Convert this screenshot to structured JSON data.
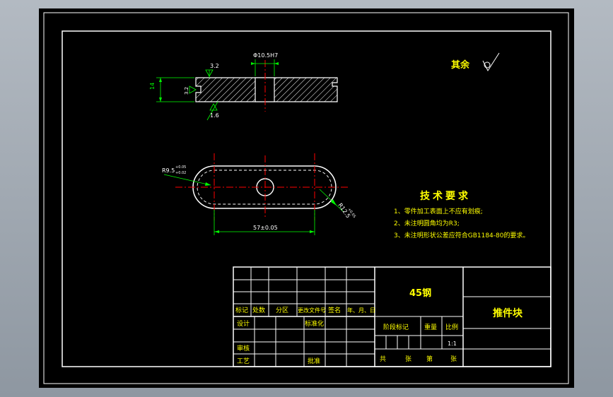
{
  "colors": {
    "background": "#000000",
    "frame": "#ffffff",
    "geometry": "#ffffff",
    "dimension": "#00ff00",
    "centerline": "#ff0000",
    "hatch": "#ffffff",
    "text_yellow": "#ffff00",
    "text_green": "#00ff00",
    "text_white": "#ffffff"
  },
  "section_view": {
    "roughness_top": "3.2",
    "roughness_left": "3.2",
    "roughness_bottom": "1.6",
    "height_dim": "14",
    "hole_dim": "Φ10.5H7"
  },
  "plan_view": {
    "radius_left": "R9.5",
    "radius_left_tol_upper": "+0.05",
    "radius_left_tol_lower": "+0.02",
    "radius_right": "R12.5",
    "radius_right_tol": "+0.05",
    "length_dim": "57±0.05"
  },
  "roughness_note": {
    "label": "其余"
  },
  "tech_requirements": {
    "title": "技术要求",
    "items": [
      "1、零件加工表面上不应有划痕;",
      "2、未注明圆角均为R3;",
      "3、未注明形状公差应符合GB1184-80的要求。"
    ]
  },
  "title_block": {
    "material": "45钢",
    "part_name": "推件块",
    "rev_headers": [
      "标记",
      "处数",
      "分区",
      "更改文件号",
      "签名",
      "年、月、日"
    ],
    "design": "设计",
    "standardize": "标准化",
    "review": "审核",
    "process": "工艺",
    "approve": "批准",
    "stage_mark": "阶段标记",
    "weight": "重量",
    "scale_label": "比例",
    "scale_value": "1:1",
    "sheets_total": "共",
    "sheets_unit": "张",
    "sheet_no": "第",
    "sheet_unit2": "张"
  }
}
